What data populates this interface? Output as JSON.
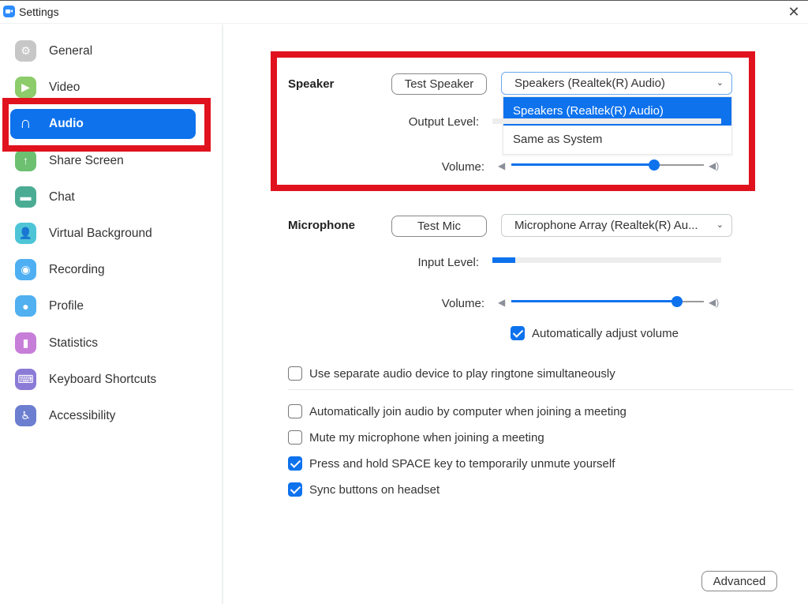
{
  "window": {
    "title": "Settings",
    "close_icon": "close-icon"
  },
  "sidebar": {
    "items": [
      {
        "label": "General",
        "icon": "gear-icon",
        "color": "#c7c7c7",
        "glyph": "⚙",
        "active": false
      },
      {
        "label": "Video",
        "icon": "video-camera-icon",
        "color": "#8ccc6a",
        "glyph": "▶",
        "active": false
      },
      {
        "label": "Audio",
        "icon": "headphones-icon",
        "color": "#0e72ed",
        "glyph": "🎧",
        "active": true
      },
      {
        "label": "Share Screen",
        "icon": "share-screen-icon",
        "color": "#6cc070",
        "glyph": "↑",
        "active": false
      },
      {
        "label": "Chat",
        "icon": "chat-bubble-icon",
        "color": "#4bac94",
        "glyph": "▬",
        "active": false
      },
      {
        "label": "Virtual Background",
        "icon": "virtual-background-icon",
        "color": "#4ec5d6",
        "glyph": "👤",
        "active": false
      },
      {
        "label": "Recording",
        "icon": "recording-icon",
        "color": "#4eb0f2",
        "glyph": "◉",
        "active": false
      },
      {
        "label": "Profile",
        "icon": "profile-icon",
        "color": "#50b0f0",
        "glyph": "●",
        "active": false
      },
      {
        "label": "Statistics",
        "icon": "statistics-icon",
        "color": "#c77ed8",
        "glyph": "▮",
        "active": false
      },
      {
        "label": "Keyboard Shortcuts",
        "icon": "keyboard-icon",
        "color": "#8b7ad6",
        "glyph": "⌨",
        "active": false
      },
      {
        "label": "Accessibility",
        "icon": "accessibility-icon",
        "color": "#6b7ed0",
        "glyph": "♿",
        "active": false
      }
    ]
  },
  "speaker": {
    "title": "Speaker",
    "test_button": "Test Speaker",
    "device_selected": "Speakers (Realtek(R) Audio)",
    "dropdown_options": [
      {
        "label": "Speakers (Realtek(R) Audio)",
        "selected": true
      },
      {
        "label": "Same as System",
        "selected": false
      }
    ],
    "output_level_label": "Output Level:",
    "output_level_percent": 0,
    "volume_label": "Volume:",
    "volume_percent": 74
  },
  "microphone": {
    "title": "Microphone",
    "test_button": "Test Mic",
    "device_selected": "Microphone Array (Realtek(R) Au...",
    "input_level_label": "Input Level:",
    "input_level_percent": 10,
    "volume_label": "Volume:",
    "volume_percent": 86,
    "auto_adjust": {
      "label": "Automatically adjust volume",
      "checked": true
    }
  },
  "options": {
    "separate_ringtone": {
      "label": "Use separate audio device to play ringtone simultaneously",
      "checked": false
    },
    "list": [
      {
        "label": "Automatically join audio by computer when joining a meeting",
        "checked": false
      },
      {
        "label": "Mute my microphone when joining a meeting",
        "checked": false
      },
      {
        "label": "Press and hold SPACE key to temporarily unmute yourself",
        "checked": true
      },
      {
        "label": "Sync buttons on headset",
        "checked": true
      }
    ]
  },
  "advanced_button": "Advanced",
  "colors": {
    "accent": "#0e72ed",
    "highlight": "#e0121d"
  }
}
